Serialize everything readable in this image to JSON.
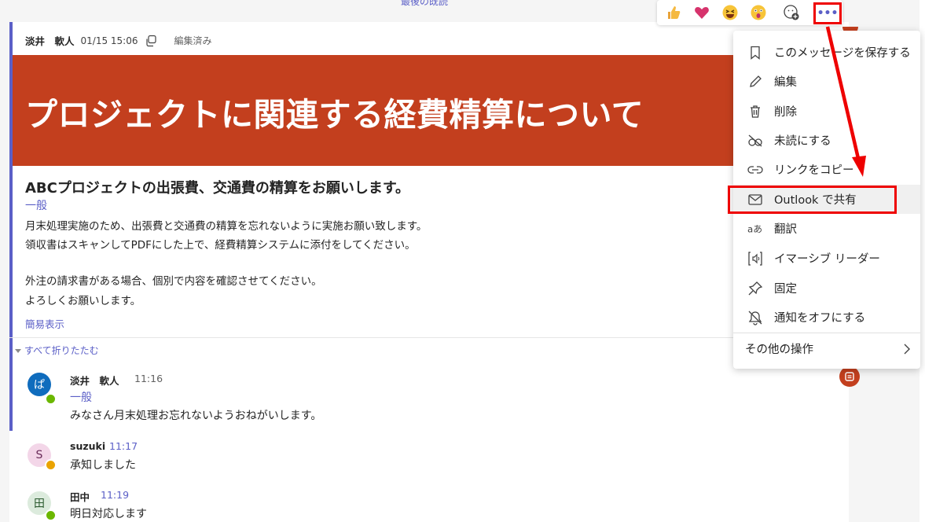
{
  "top": {
    "last_read": "最後の既読"
  },
  "post": {
    "author": "淡井　軟人",
    "timestamp": "01/15 15:06",
    "edited": "編集済み",
    "banner_title": "プロジェクトに関連する経費精算について",
    "subject": "ABCプロジェクトの出張費、交通費の精算をお願いします。",
    "channel": "一般",
    "body": [
      "月末処理実施のため、出張費と交通費の精算を忘れないように実施お願い致します。",
      "領収書はスキャンしてPDFにした上で、経費精算システムに添付をしてください。",
      "外注の請求書がある場合、個別で内容を確認させてください。",
      "よろしくお願いします。"
    ],
    "simple_view": "簡易表示",
    "collapse_all": "すべて折りたたむ"
  },
  "replies": [
    {
      "avatar": "ぱ",
      "author": "淡井　軟人",
      "time": "11:16",
      "channel": "一般",
      "text": "みなさん月末処理お忘れないようおねがいします。",
      "avatar_bg": "#0f6cbd",
      "presence": "#6bb700"
    },
    {
      "avatar": "S",
      "author": "suzuki",
      "time": "11:17",
      "text": "承知しました",
      "avatar_bg": "#f3d6e8",
      "presence": "#eaa300"
    },
    {
      "avatar": "田",
      "author": "田中",
      "time": "11:19",
      "text": "明日対応します",
      "avatar_bg": "#dcebdd",
      "presence": "#6bb700"
    }
  ],
  "reactions": [
    "like-icon",
    "heart-icon",
    "laugh-icon",
    "surprised-icon",
    "add-reaction-icon"
  ],
  "more_options": "•••",
  "menu": {
    "items": [
      {
        "label": "このメッセージを保存する",
        "icon": "bookmark-icon"
      },
      {
        "label": "編集",
        "icon": "pencil-icon"
      },
      {
        "label": "削除",
        "icon": "trash-icon"
      },
      {
        "label": "未読にする",
        "icon": "unread-icon"
      },
      {
        "label": "リンクをコピー",
        "icon": "link-icon"
      },
      {
        "label": "Outlook で共有",
        "icon": "mail-icon"
      },
      {
        "label": "翻訳",
        "icon": "translate-icon"
      },
      {
        "label": "イマーシブ リーダー",
        "icon": "immersive-reader-icon"
      },
      {
        "label": "固定",
        "icon": "pin-icon"
      },
      {
        "label": "通知をオフにする",
        "icon": "bell-off-icon"
      }
    ],
    "other_actions": "その他の操作"
  },
  "colors": {
    "accent": "#5b5fc7",
    "banner": "#c33f1e",
    "highlight": "#e00000"
  }
}
